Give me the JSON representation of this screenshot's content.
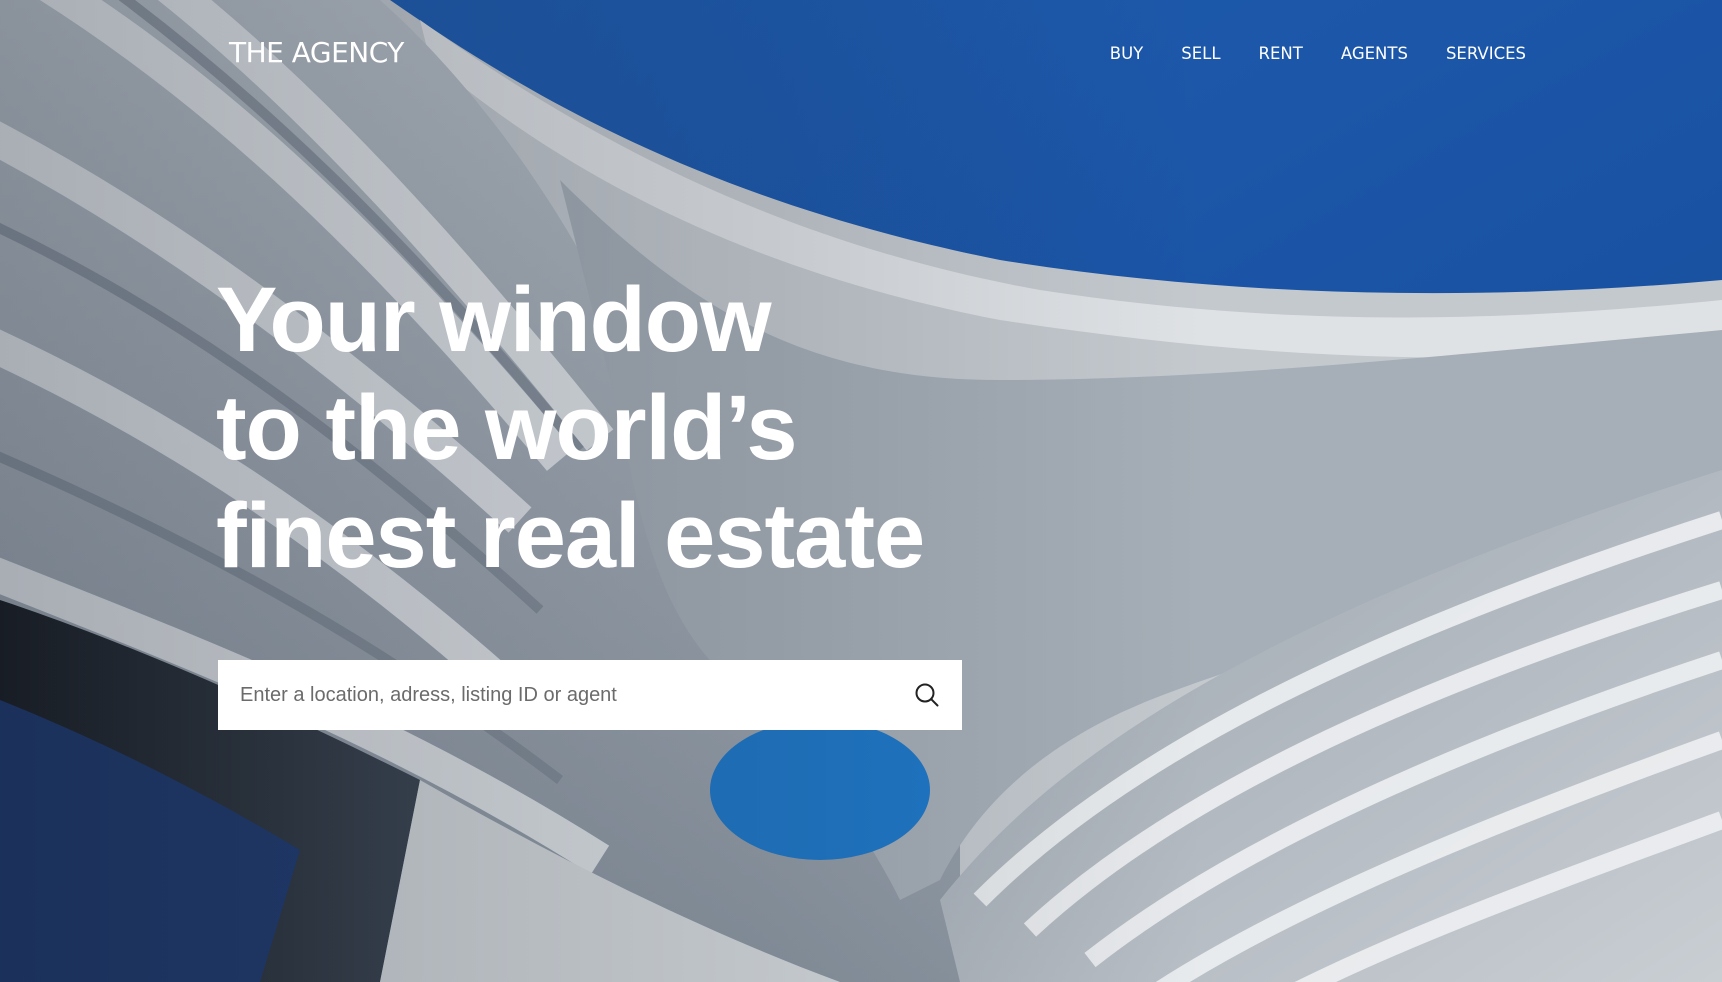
{
  "brand": {
    "logo": "THE AGENCY"
  },
  "nav": {
    "items": [
      {
        "label": "BUY"
      },
      {
        "label": "SELL"
      },
      {
        "label": "RENT"
      },
      {
        "label": "AGENTS"
      },
      {
        "label": "SERVICES"
      }
    ]
  },
  "hero": {
    "headline_lines": [
      "Your window",
      "to the world’s",
      "finest real estate"
    ]
  },
  "search": {
    "placeholder": "Enter a location, adress, listing ID or agent",
    "value": "",
    "icon": "search-icon"
  },
  "colors": {
    "sky": "#1b55a8",
    "text": "#ffffff",
    "search_bg": "#ffffff"
  }
}
